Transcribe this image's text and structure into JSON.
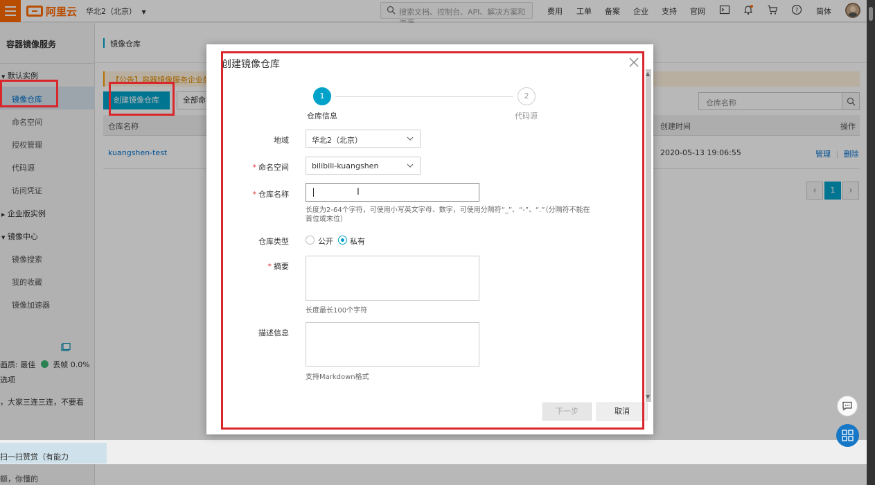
{
  "topbar": {
    "logo_text": "阿里云",
    "region": "华北2（北京）",
    "search_placeholder": "搜索文档、控制台、API、解决方案和资源",
    "nav": [
      "费用",
      "工单",
      "备案",
      "企业",
      "支持",
      "官网"
    ],
    "lang": "简体"
  },
  "sidebar": {
    "title": "容器镜像服务",
    "group_default": "默认实例",
    "items_default": [
      "镜像仓库",
      "命名空间",
      "授权管理",
      "代码源",
      "访问凭证"
    ],
    "group_enterprise": "企业版实例",
    "group_center": "镜像中心",
    "items_center": [
      "镜像搜索",
      "我的收藏",
      "镜像加速器"
    ]
  },
  "player_overlay": {
    "quality": "画质: 最佳",
    "drop": "丢帧 0.0%",
    "options": "选项",
    "comment1": "，大家三连三连，不要看",
    "comment2": "扫一扫赞赏（有能力",
    "comment3": "额，你懂的"
  },
  "main": {
    "breadcrumb": "镜像仓库",
    "notice": "【公告】容器镜像服务企业版已",
    "create_button": "创建镜像仓库",
    "all_dropdown": "全部命名",
    "search_placeholder": "仓库名称",
    "columns": {
      "name": "仓库名称",
      "created": "创建时间",
      "actions": "操作"
    },
    "row": {
      "name": "kuangshen-test",
      "created": "2020-05-13 19:06:55",
      "manage": "管理",
      "delete": "删除",
      "sep": "|"
    },
    "pager": {
      "prev": "‹",
      "page": "1",
      "next": "›"
    }
  },
  "modal": {
    "title": "创建镜像仓库",
    "steps": [
      {
        "num": "1",
        "label": "仓库信息"
      },
      {
        "num": "2",
        "label": "代码源"
      }
    ],
    "region_label": "地域",
    "region_value": "华北2（北京）",
    "namespace_label": "命名空间",
    "namespace_value": "bilibili-kuangshen",
    "repo_name_label": "仓库名称",
    "repo_name_hint": "长度为2-64个字符，可使用小写英文字母、数字，可使用分隔符“_”、“-”、“.”（分隔符不能在首位或末位）",
    "repo_type_label": "仓库类型",
    "repo_type_public": "公开",
    "repo_type_private": "私有",
    "summary_label": "摘要",
    "summary_hint": "长度最长100个字符",
    "desc_label": "描述信息",
    "desc_hint": "支持Markdown格式",
    "required_mark": "*",
    "next_button": "下一步",
    "cancel_button": "取消"
  },
  "colors": {
    "brand": "#ff6a00",
    "primary": "#00a2ca",
    "annotation": "#d9262b",
    "link": "#0070cc"
  }
}
